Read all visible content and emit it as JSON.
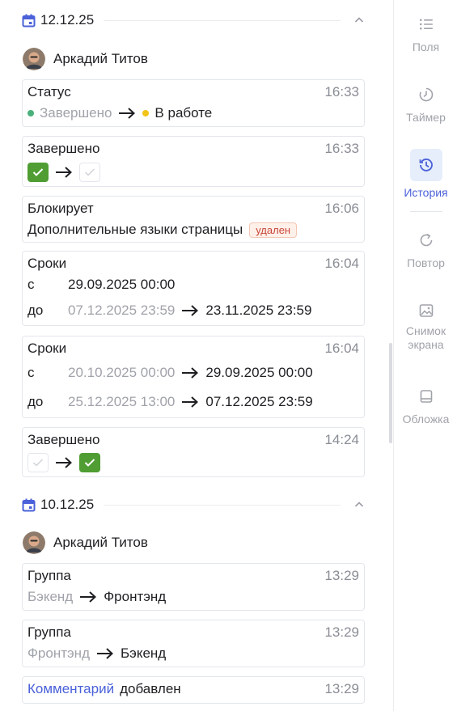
{
  "history": {
    "groups": [
      {
        "date": "12.12.25",
        "author": "Аркадий Титов",
        "entries": [
          {
            "title": "Статус",
            "time": "16:33",
            "from": "Завершено",
            "to": "В работе",
            "from_color": "#4ab07b",
            "to_color": "#f2c318"
          },
          {
            "title": "Завершено",
            "time": "16:33",
            "from_checked": true,
            "to_checked": false
          },
          {
            "title": "Блокирует",
            "time": "16:06",
            "task": "Дополнительные языки страницы",
            "badge": "удален"
          },
          {
            "title": "Сроки",
            "time": "16:04",
            "start_label": "с",
            "start_to": "29.09.2025 00:00",
            "end_label": "до",
            "end_from": "07.12.2025 23:59",
            "end_to": "23.11.2025 23:59"
          },
          {
            "title": "Сроки",
            "time": "16:04",
            "start_label": "с",
            "start_from": "20.10.2025 00:00",
            "start_to": "29.09.2025 00:00",
            "end_label": "до",
            "end_from": "25.12.2025 13:00",
            "end_to": "07.12.2025 23:59"
          },
          {
            "title": "Завершено",
            "time": "14:24",
            "from_checked": false,
            "to_checked": true
          }
        ]
      },
      {
        "date": "10.12.25",
        "author": "Аркадий Титов",
        "entries": [
          {
            "title": "Группа",
            "time": "13:29",
            "from": "Бэкенд",
            "to": "Фронтэнд"
          },
          {
            "title": "Группа",
            "time": "13:29",
            "from": "Фронтэнд",
            "to": "Бэкенд"
          },
          {
            "link": "Комментарий",
            "text": "добавлен",
            "time": "13:29"
          }
        ]
      }
    ]
  },
  "sidebar": {
    "items": [
      {
        "label": "Поля",
        "icon": "list-icon"
      },
      {
        "label": "Таймер",
        "icon": "timer-icon"
      },
      {
        "label": "История",
        "icon": "history-icon",
        "active": true
      },
      {
        "label": "Повтор",
        "icon": "repeat-icon"
      },
      {
        "label": "Снимок экрана",
        "icon": "image-icon"
      },
      {
        "label": "Обложка",
        "icon": "cover-icon"
      }
    ]
  },
  "colors": {
    "accent": "#4a61d9",
    "check_green": "#4f9d33",
    "badge_red": "#c8473a"
  }
}
